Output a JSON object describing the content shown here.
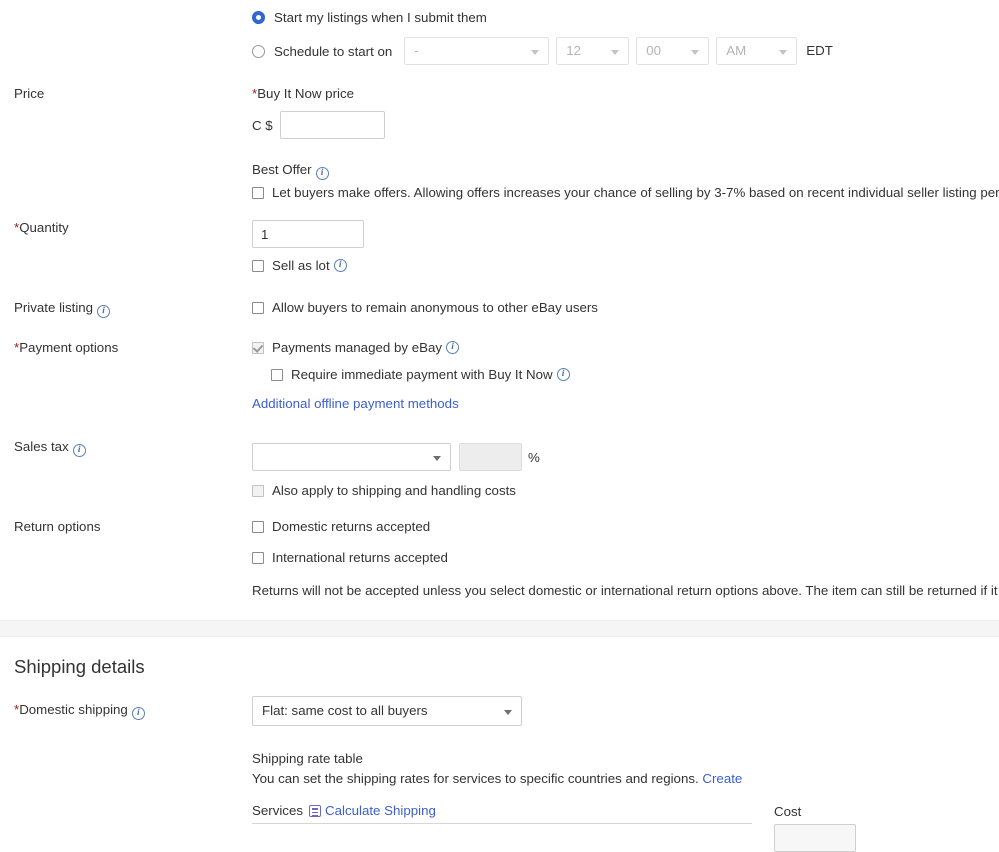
{
  "schedule": {
    "option_immediate": "Start my listings when I submit them",
    "option_scheduled": "Schedule to start on",
    "immediate_selected": true,
    "date_value": "-",
    "hour_value": "12",
    "minute_value": "00",
    "meridiem_value": "AM",
    "timezone": "EDT"
  },
  "price": {
    "label": "Price",
    "buy_it_now_label": "Buy It Now price",
    "buy_it_now_required_mark": "*",
    "currency_prefix": "C $",
    "price_value": "",
    "best_offer_label": "Best Offer",
    "best_offer_checkbox_text": "Let buyers make offers. Allowing offers increases your chance of selling by 3-7% based on recent individual seller listing perf"
  },
  "quantity": {
    "label": "Quantity",
    "required_mark": "*",
    "value": "1",
    "sell_as_lot_label": "Sell as lot"
  },
  "private_listing": {
    "label": "Private listing",
    "checkbox_text": "Allow buyers to remain anonymous to other eBay users"
  },
  "payment_options": {
    "label": "Payment options",
    "required_mark": "*",
    "managed_by_ebay_text": "Payments managed by eBay",
    "managed_by_ebay_checked": true,
    "immediate_payment_text": "Require immediate payment with Buy It Now",
    "additional_methods_link": "Additional offline payment methods"
  },
  "sales_tax": {
    "label": "Sales tax",
    "state_value": "",
    "rate_value": "",
    "percent_symbol": "%",
    "also_apply_text": "Also apply to shipping and handling costs"
  },
  "return_options": {
    "label": "Return options",
    "domestic_text": "Domestic returns accepted",
    "international_text": "International returns accepted",
    "note": "Returns will not be accepted unless you select domestic or international return options above. The item can still be returned if it"
  },
  "shipping": {
    "section_title": "Shipping details",
    "domestic_label": "Domestic shipping",
    "domestic_required_mark": "*",
    "domestic_value": "Flat: same cost to all buyers",
    "rate_table_title": "Shipping rate table",
    "rate_table_desc": "You can set the shipping rates for services to specific countries and regions.",
    "rate_table_create_link": "Create",
    "services_header": "Services",
    "calculate_shipping_link": "Calculate Shipping",
    "cost_header": "Cost"
  },
  "colors": {
    "accent_blue": "#3068d4",
    "link_blue": "#3c5fd0",
    "required_red": "#a02020",
    "band_gray": "#f5f5f5"
  }
}
